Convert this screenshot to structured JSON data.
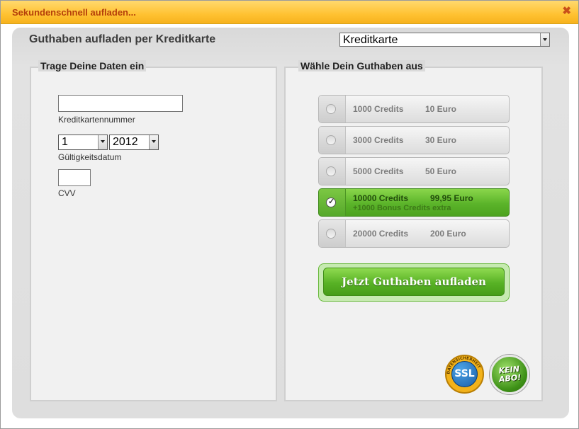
{
  "title": "Sekundenschnell aufladen...",
  "close_icon": "close-icon",
  "heading": "Guthaben aufladen per Kreditkarte",
  "payment_method": {
    "selected": "Kreditkarte"
  },
  "left": {
    "legend": "Trage Deine Daten ein",
    "card_number": {
      "value": "",
      "label": "Kreditkartennummer"
    },
    "expiry": {
      "month": "1",
      "year": "2012",
      "label": "Gültigkeitsdatum"
    },
    "cvv": {
      "value": "",
      "label": "CVV"
    }
  },
  "right": {
    "legend": "Wähle Dein Guthaben aus",
    "options": [
      {
        "credits": "1000 Credits",
        "price": "10 Euro",
        "selected": false
      },
      {
        "credits": "3000 Credits",
        "price": "30 Euro",
        "selected": false
      },
      {
        "credits": "5000 Credits",
        "price": "50 Euro",
        "selected": false
      },
      {
        "credits": "10000 Credits",
        "price": "99,95 Euro",
        "bonus": "+1000 Bonus Credits extra",
        "selected": true
      },
      {
        "credits": "20000 Credits",
        "price": "200 Euro",
        "selected": false
      }
    ],
    "submit_label": "Jetzt Guthaben aufladen"
  },
  "badges": {
    "ssl": {
      "main": "SSL",
      "ring": "DATENSICHERHEIT"
    },
    "abo": {
      "line1": "KEIN",
      "line2": "ABO!"
    }
  },
  "colors": {
    "titlebar": "#ffc232",
    "title_text": "#b53f0a",
    "selected_option": "#5bb42a",
    "button": "#58b225"
  }
}
